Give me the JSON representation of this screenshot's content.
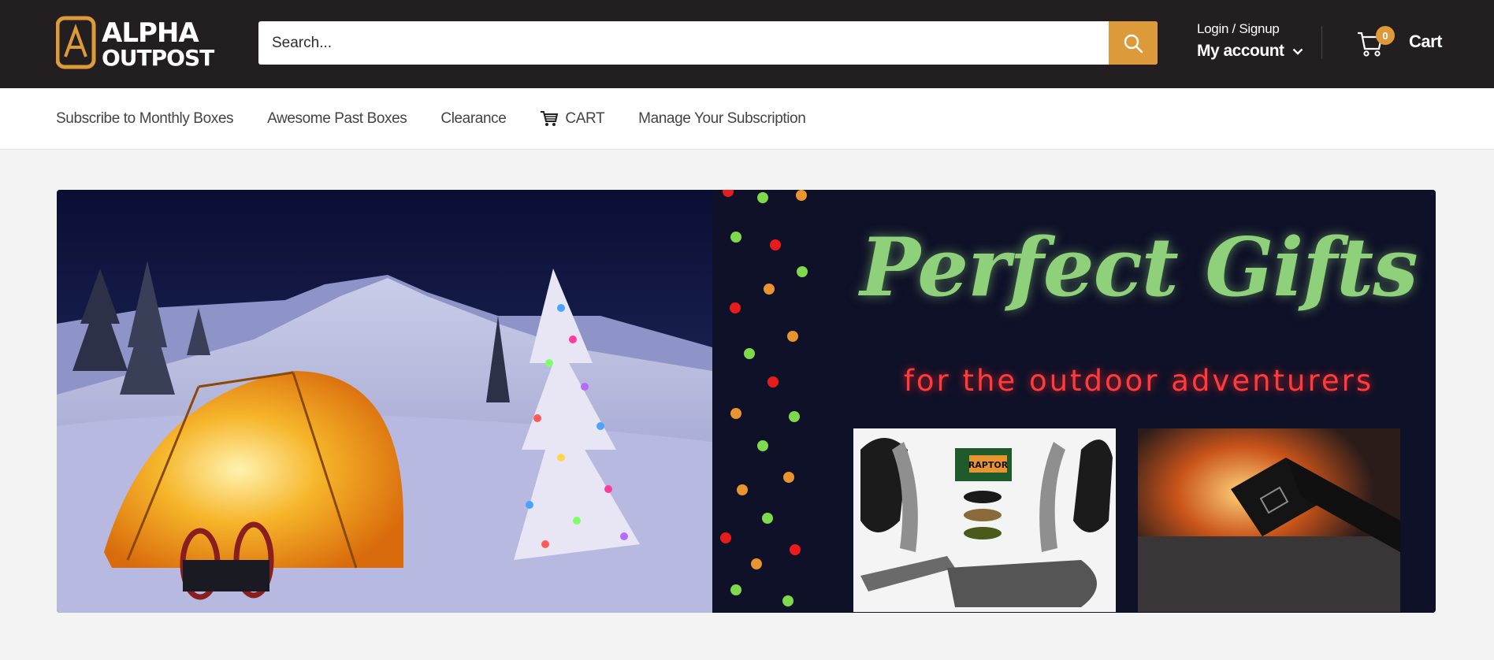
{
  "brand": {
    "logo_text_top": "ALPHA",
    "logo_text_bottom": "OUTPOST",
    "accent_color": "#dc9a3a",
    "header_bg": "#231f20"
  },
  "search": {
    "placeholder": "Search..."
  },
  "account": {
    "login_label": "Login / Signup",
    "my_account_label": "My account"
  },
  "cart": {
    "count": "0",
    "label": "Cart"
  },
  "nav": {
    "items": [
      {
        "label": "Subscribe to Monthly Boxes"
      },
      {
        "label": "Awesome Past Boxes"
      },
      {
        "label": "Clearance"
      },
      {
        "label": "CART",
        "icon": "shopping-cart-icon"
      },
      {
        "label": "Manage Your Subscription"
      }
    ]
  },
  "banner": {
    "title": "Perfect Gifts",
    "subtitle": "for the outdoor adventurers",
    "product_badge": "RAPTOR"
  }
}
